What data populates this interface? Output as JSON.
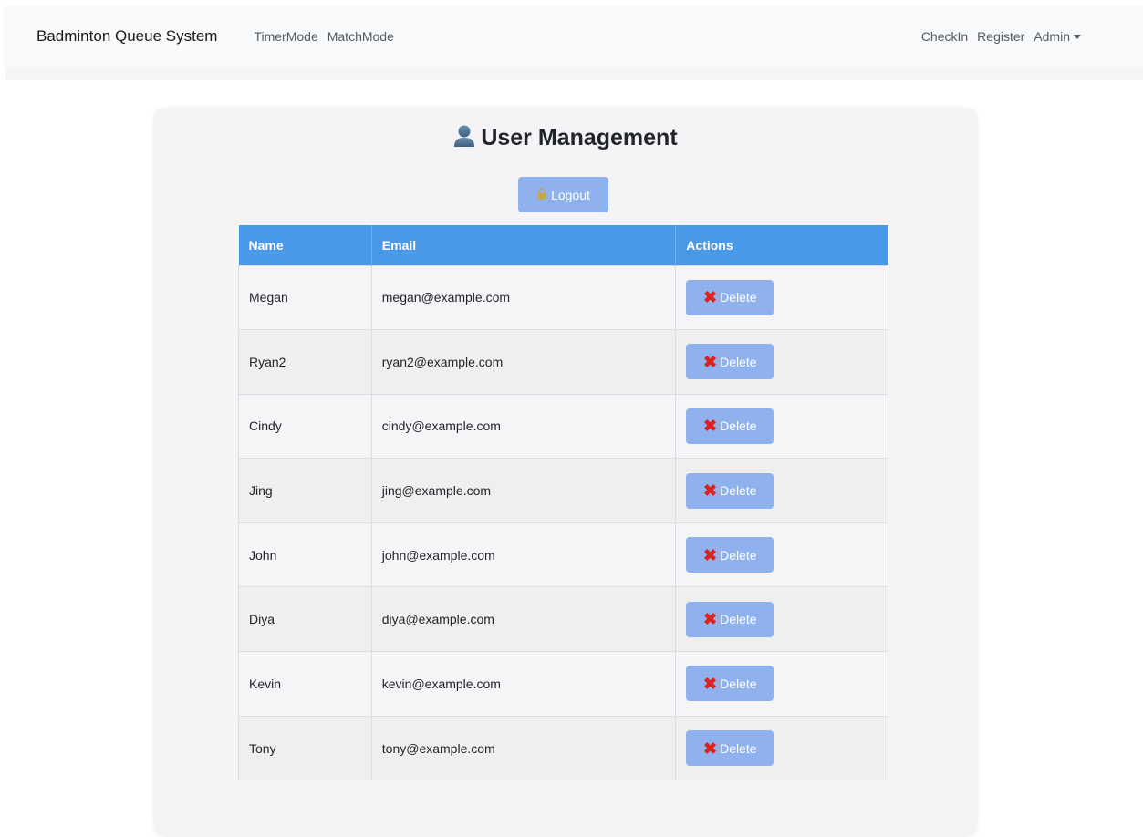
{
  "navbar": {
    "brand": "Badminton Queue System",
    "left_links": [
      "TimerMode",
      "MatchMode"
    ],
    "right_links": [
      "CheckIn",
      "Register"
    ],
    "admin_label": "Admin"
  },
  "page": {
    "title": "User Management",
    "title_icon": "user-silhouette-icon",
    "logout_label": "Logout",
    "logout_icon": "lock-icon"
  },
  "table": {
    "headers": [
      "Name",
      "Email",
      "Actions"
    ],
    "delete_label": "Delete",
    "delete_icon": "x-mark-icon",
    "rows": [
      {
        "name": "Megan",
        "email": "megan@example.com"
      },
      {
        "name": "Ryan2",
        "email": "ryan2@example.com"
      },
      {
        "name": "Cindy",
        "email": "cindy@example.com"
      },
      {
        "name": "Jing",
        "email": "jing@example.com"
      },
      {
        "name": "John",
        "email": "john@example.com"
      },
      {
        "name": "Diya",
        "email": "diya@example.com"
      },
      {
        "name": "Kevin",
        "email": "kevin@example.com"
      },
      {
        "name": "Tony",
        "email": "tony@example.com"
      }
    ]
  },
  "colors": {
    "header_blue": "#4a98e8",
    "button_blue": "#8fb2ee",
    "delete_x_red": "#e0201b"
  }
}
